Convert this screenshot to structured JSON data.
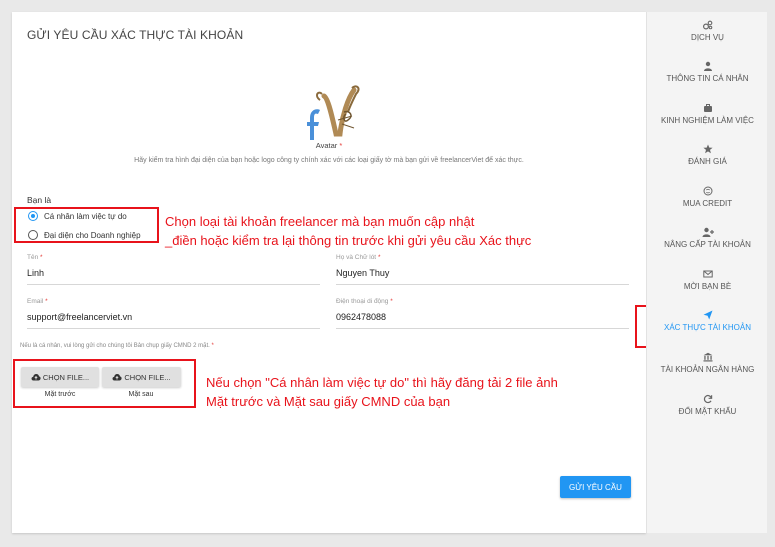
{
  "page": {
    "title": "GỬI YÊU CẦU XÁC THỰC TÀI KHOẢN",
    "avatar_label": "Avatar",
    "avatar_required": "*",
    "avatar_hint": "Hãy kiểm tra hình đại diện của bạn hoặc logo công ty chính xác với các loại giấy tờ mà bạn gửi về freelancerViet để xác thực."
  },
  "account_type": {
    "label": "Bạn là",
    "options": [
      {
        "label": "Cá nhân làm việc tự do",
        "selected": true
      },
      {
        "label": "Đại diện cho Doanh nghiệp",
        "selected": false
      }
    ]
  },
  "fields": {
    "first_name": {
      "label": "Tên",
      "required": "*",
      "value": "Linh"
    },
    "last_name": {
      "label": "Họ và Chữ lót",
      "required": "*",
      "value": "Nguyen Thuy"
    },
    "email": {
      "label": "Email",
      "required": "*",
      "value": "support@freelancerviet.vn"
    },
    "phone": {
      "label": "Điện thoại di động",
      "required": "*",
      "value": "0962478088"
    }
  },
  "upload": {
    "hint": "Nếu là cá nhân, vui lòng gửi cho chúng tôi Bản chụp giấy CMND 2 mặt.",
    "hint_required": "*",
    "front_button": "CHỌN FILE...",
    "front_caption": "Mặt trước",
    "back_button": "CHỌN FILE...",
    "back_caption": "Mặt sau"
  },
  "submit_label": "GỬI YÊU CẦU",
  "annotations": {
    "account_note_line1": "Chọn loại tài khoản freelancer mà bạn muốn cập nhật",
    "account_note_line2": "_điền hoặc kiểm tra lại thông tin trước khi gửi yêu cầu Xác thực",
    "upload_note_line1": "Nếu chọn \"Cá nhân làm việc tự do\" thì hãy đăng tải 2 file ảnh",
    "upload_note_line2": "Mặt trước và Mặt sau giấy CMND của bạn"
  },
  "sidebar": {
    "items": [
      {
        "label": "DỊCH VỤ",
        "icon": "services-icon"
      },
      {
        "label": "THÔNG TIN CÁ NHÂN",
        "icon": "user-icon"
      },
      {
        "label": "KINH NGHIỆM LÀM VIỆC",
        "icon": "briefcase-icon"
      },
      {
        "label": "ĐÁNH GIÁ",
        "icon": "star-icon"
      },
      {
        "label": "MUA CREDIT",
        "icon": "coin-icon"
      },
      {
        "label": "NÂNG CẤP TÀI KHOẢN",
        "icon": "user-plus-icon"
      },
      {
        "label": "MỜI BẠN BÈ",
        "icon": "envelope-icon"
      },
      {
        "label": "XÁC THỰC TÀI KHOẢN",
        "icon": "send-icon",
        "active": true
      },
      {
        "label": "TÀI KHOẢN NGÂN HÀNG",
        "icon": "bank-icon"
      },
      {
        "label": "ĐỔI MẬT KHẨU",
        "icon": "refresh-icon"
      }
    ]
  },
  "colors": {
    "accent": "#2196f3",
    "annotation": "#e8131b"
  }
}
